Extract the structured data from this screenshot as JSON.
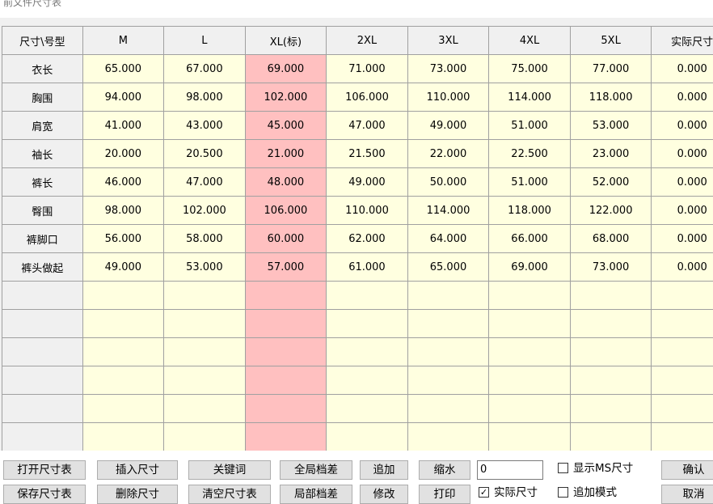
{
  "window": {
    "title": "前文件尺寸表"
  },
  "table": {
    "corner": "尺寸\\号型",
    "sizes": [
      "M",
      "L",
      "XL(标)",
      "2XL",
      "3XL",
      "4XL",
      "5XL",
      "实际尺寸"
    ],
    "rows": [
      {
        "name": "衣长",
        "values": [
          "65.000",
          "67.000",
          "69.000",
          "71.000",
          "73.000",
          "75.000",
          "77.000",
          "0.000"
        ]
      },
      {
        "name": "胸围",
        "values": [
          "94.000",
          "98.000",
          "102.000",
          "106.000",
          "110.000",
          "114.000",
          "118.000",
          "0.000"
        ]
      },
      {
        "name": "肩宽",
        "values": [
          "41.000",
          "43.000",
          "45.000",
          "47.000",
          "49.000",
          "51.000",
          "53.000",
          "0.000"
        ]
      },
      {
        "name": "袖长",
        "values": [
          "20.000",
          "20.500",
          "21.000",
          "21.500",
          "22.000",
          "22.500",
          "23.000",
          "0.000"
        ]
      },
      {
        "name": "裤长",
        "values": [
          "46.000",
          "47.000",
          "48.000",
          "49.000",
          "50.000",
          "51.000",
          "52.000",
          "0.000"
        ]
      },
      {
        "name": "臀围",
        "values": [
          "98.000",
          "102.000",
          "106.000",
          "110.000",
          "114.000",
          "118.000",
          "122.000",
          "0.000"
        ]
      },
      {
        "name": "裤脚口",
        "values": [
          "56.000",
          "58.000",
          "60.000",
          "62.000",
          "64.000",
          "66.000",
          "68.000",
          "0.000"
        ]
      },
      {
        "name": "裤头做起",
        "values": [
          "49.000",
          "53.000",
          "57.000",
          "61.000",
          "65.000",
          "69.000",
          "73.000",
          "0.000"
        ]
      }
    ],
    "empty_rows": 6,
    "standard_col": 2
  },
  "buttons": {
    "open_size_table": "打开尺寸表",
    "save_size_table": "保存尺寸表",
    "insert_size": "插入尺寸",
    "delete_size": "删除尺寸",
    "keyword": "关键词",
    "clear_size_table": "清空尺寸表",
    "global_grade": "全局档差",
    "local_grade": "局部档差",
    "append": "追加",
    "modify": "修改",
    "shrink": "缩水",
    "print": "打印",
    "confirm": "确认",
    "cancel": "取消"
  },
  "shrink_input": {
    "value": "0"
  },
  "checkboxes": {
    "show_ms_size": {
      "label": "显示MS尺寸",
      "checked": false
    },
    "actual_size": {
      "label": "实际尺寸",
      "checked": true
    },
    "append_mode": {
      "label": "追加模式",
      "checked": false
    }
  },
  "colors": {
    "cell_bg": "#ffffe0",
    "standard_col_bg": "#ffc0c0",
    "header_bg": "#f0f0f0"
  }
}
